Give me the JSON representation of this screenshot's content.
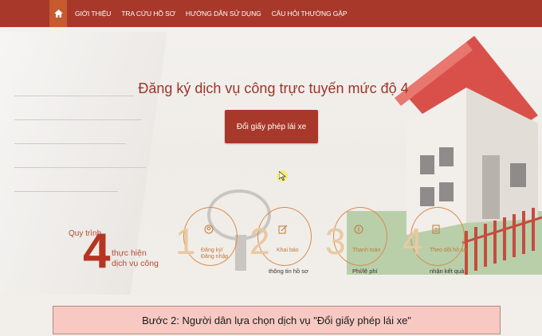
{
  "nav": {
    "items": [
      "GIỚI THIỆU",
      "TRA CỨU HỒ SƠ",
      "HƯỚNG DẪN SỬ DỤNG",
      "CÂU HỎI THƯỜNG GẶP"
    ]
  },
  "hero": {
    "title": "Đăng ký dịch vụ công trực tuyến mức độ 4",
    "button_label": "Đổi giấy phép lái xe"
  },
  "process": {
    "label": "Quy trình",
    "number": "4",
    "subtitle_line1": "thực hiện",
    "subtitle_line2": "dịch vụ công"
  },
  "steps": [
    {
      "num": "1",
      "line1": "Đăng ký/",
      "line2": "Đăng nhập"
    },
    {
      "num": "2",
      "line1": "Khai báo",
      "line2": "thông tin hồ sơ"
    },
    {
      "num": "3",
      "line1": "Thanh toán",
      "line2": "Phí/lệ phí"
    },
    {
      "num": "4",
      "line1": "Theo dõi hồ sơ",
      "line2": "nhận kết quả"
    }
  ],
  "caption": "Bước 2: Người dân lựa chọn dịch vụ \"Đổi giấy phép lái xe\"",
  "colors": {
    "nav": "#a8382a",
    "accent": "#c75a2f",
    "title": "#9b3529",
    "caption_bg": "#f7c9c2"
  }
}
